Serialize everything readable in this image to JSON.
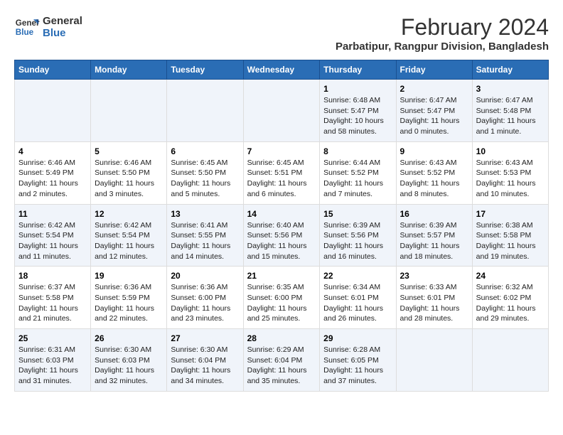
{
  "header": {
    "logo_line1": "General",
    "logo_line2": "Blue",
    "title": "February 2024",
    "subtitle": "Parbatipur, Rangpur Division, Bangladesh"
  },
  "weekdays": [
    "Sunday",
    "Monday",
    "Tuesday",
    "Wednesday",
    "Thursday",
    "Friday",
    "Saturday"
  ],
  "weeks": [
    [
      {
        "day": "",
        "info": ""
      },
      {
        "day": "",
        "info": ""
      },
      {
        "day": "",
        "info": ""
      },
      {
        "day": "",
        "info": ""
      },
      {
        "day": "1",
        "info": "Sunrise: 6:48 AM\nSunset: 5:47 PM\nDaylight: 10 hours\nand 58 minutes."
      },
      {
        "day": "2",
        "info": "Sunrise: 6:47 AM\nSunset: 5:47 PM\nDaylight: 11 hours\nand 0 minutes."
      },
      {
        "day": "3",
        "info": "Sunrise: 6:47 AM\nSunset: 5:48 PM\nDaylight: 11 hours\nand 1 minute."
      }
    ],
    [
      {
        "day": "4",
        "info": "Sunrise: 6:46 AM\nSunset: 5:49 PM\nDaylight: 11 hours\nand 2 minutes."
      },
      {
        "day": "5",
        "info": "Sunrise: 6:46 AM\nSunset: 5:50 PM\nDaylight: 11 hours\nand 3 minutes."
      },
      {
        "day": "6",
        "info": "Sunrise: 6:45 AM\nSunset: 5:50 PM\nDaylight: 11 hours\nand 5 minutes."
      },
      {
        "day": "7",
        "info": "Sunrise: 6:45 AM\nSunset: 5:51 PM\nDaylight: 11 hours\nand 6 minutes."
      },
      {
        "day": "8",
        "info": "Sunrise: 6:44 AM\nSunset: 5:52 PM\nDaylight: 11 hours\nand 7 minutes."
      },
      {
        "day": "9",
        "info": "Sunrise: 6:43 AM\nSunset: 5:52 PM\nDaylight: 11 hours\nand 8 minutes."
      },
      {
        "day": "10",
        "info": "Sunrise: 6:43 AM\nSunset: 5:53 PM\nDaylight: 11 hours\nand 10 minutes."
      }
    ],
    [
      {
        "day": "11",
        "info": "Sunrise: 6:42 AM\nSunset: 5:54 PM\nDaylight: 11 hours\nand 11 minutes."
      },
      {
        "day": "12",
        "info": "Sunrise: 6:42 AM\nSunset: 5:54 PM\nDaylight: 11 hours\nand 12 minutes."
      },
      {
        "day": "13",
        "info": "Sunrise: 6:41 AM\nSunset: 5:55 PM\nDaylight: 11 hours\nand 14 minutes."
      },
      {
        "day": "14",
        "info": "Sunrise: 6:40 AM\nSunset: 5:56 PM\nDaylight: 11 hours\nand 15 minutes."
      },
      {
        "day": "15",
        "info": "Sunrise: 6:39 AM\nSunset: 5:56 PM\nDaylight: 11 hours\nand 16 minutes."
      },
      {
        "day": "16",
        "info": "Sunrise: 6:39 AM\nSunset: 5:57 PM\nDaylight: 11 hours\nand 18 minutes."
      },
      {
        "day": "17",
        "info": "Sunrise: 6:38 AM\nSunset: 5:58 PM\nDaylight: 11 hours\nand 19 minutes."
      }
    ],
    [
      {
        "day": "18",
        "info": "Sunrise: 6:37 AM\nSunset: 5:58 PM\nDaylight: 11 hours\nand 21 minutes."
      },
      {
        "day": "19",
        "info": "Sunrise: 6:36 AM\nSunset: 5:59 PM\nDaylight: 11 hours\nand 22 minutes."
      },
      {
        "day": "20",
        "info": "Sunrise: 6:36 AM\nSunset: 6:00 PM\nDaylight: 11 hours\nand 23 minutes."
      },
      {
        "day": "21",
        "info": "Sunrise: 6:35 AM\nSunset: 6:00 PM\nDaylight: 11 hours\nand 25 minutes."
      },
      {
        "day": "22",
        "info": "Sunrise: 6:34 AM\nSunset: 6:01 PM\nDaylight: 11 hours\nand 26 minutes."
      },
      {
        "day": "23",
        "info": "Sunrise: 6:33 AM\nSunset: 6:01 PM\nDaylight: 11 hours\nand 28 minutes."
      },
      {
        "day": "24",
        "info": "Sunrise: 6:32 AM\nSunset: 6:02 PM\nDaylight: 11 hours\nand 29 minutes."
      }
    ],
    [
      {
        "day": "25",
        "info": "Sunrise: 6:31 AM\nSunset: 6:03 PM\nDaylight: 11 hours\nand 31 minutes."
      },
      {
        "day": "26",
        "info": "Sunrise: 6:30 AM\nSunset: 6:03 PM\nDaylight: 11 hours\nand 32 minutes."
      },
      {
        "day": "27",
        "info": "Sunrise: 6:30 AM\nSunset: 6:04 PM\nDaylight: 11 hours\nand 34 minutes."
      },
      {
        "day": "28",
        "info": "Sunrise: 6:29 AM\nSunset: 6:04 PM\nDaylight: 11 hours\nand 35 minutes."
      },
      {
        "day": "29",
        "info": "Sunrise: 6:28 AM\nSunset: 6:05 PM\nDaylight: 11 hours\nand 37 minutes."
      },
      {
        "day": "",
        "info": ""
      },
      {
        "day": "",
        "info": ""
      }
    ]
  ]
}
